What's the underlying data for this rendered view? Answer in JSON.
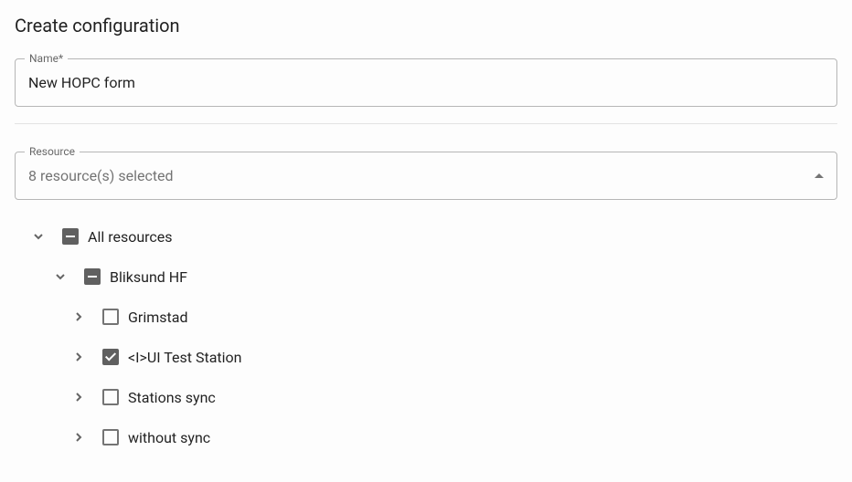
{
  "page": {
    "title": "Create configuration"
  },
  "name_field": {
    "label": "Name*",
    "value": "New HOPC form"
  },
  "resource_field": {
    "label": "Resource",
    "selected_text": "8 resource(s) selected"
  },
  "tree": {
    "root": {
      "label": "All resources",
      "state": "indeterminate",
      "expanded": true
    },
    "child": {
      "label": "Bliksund HF",
      "state": "indeterminate",
      "expanded": true
    },
    "leaves": [
      {
        "label": "Grimstad",
        "state": "unchecked",
        "expanded": false
      },
      {
        "label": "<I>UI Test Station",
        "state": "checked",
        "expanded": false
      },
      {
        "label": "Stations sync",
        "state": "unchecked",
        "expanded": false
      },
      {
        "label": "without sync",
        "state": "unchecked",
        "expanded": false
      }
    ]
  }
}
